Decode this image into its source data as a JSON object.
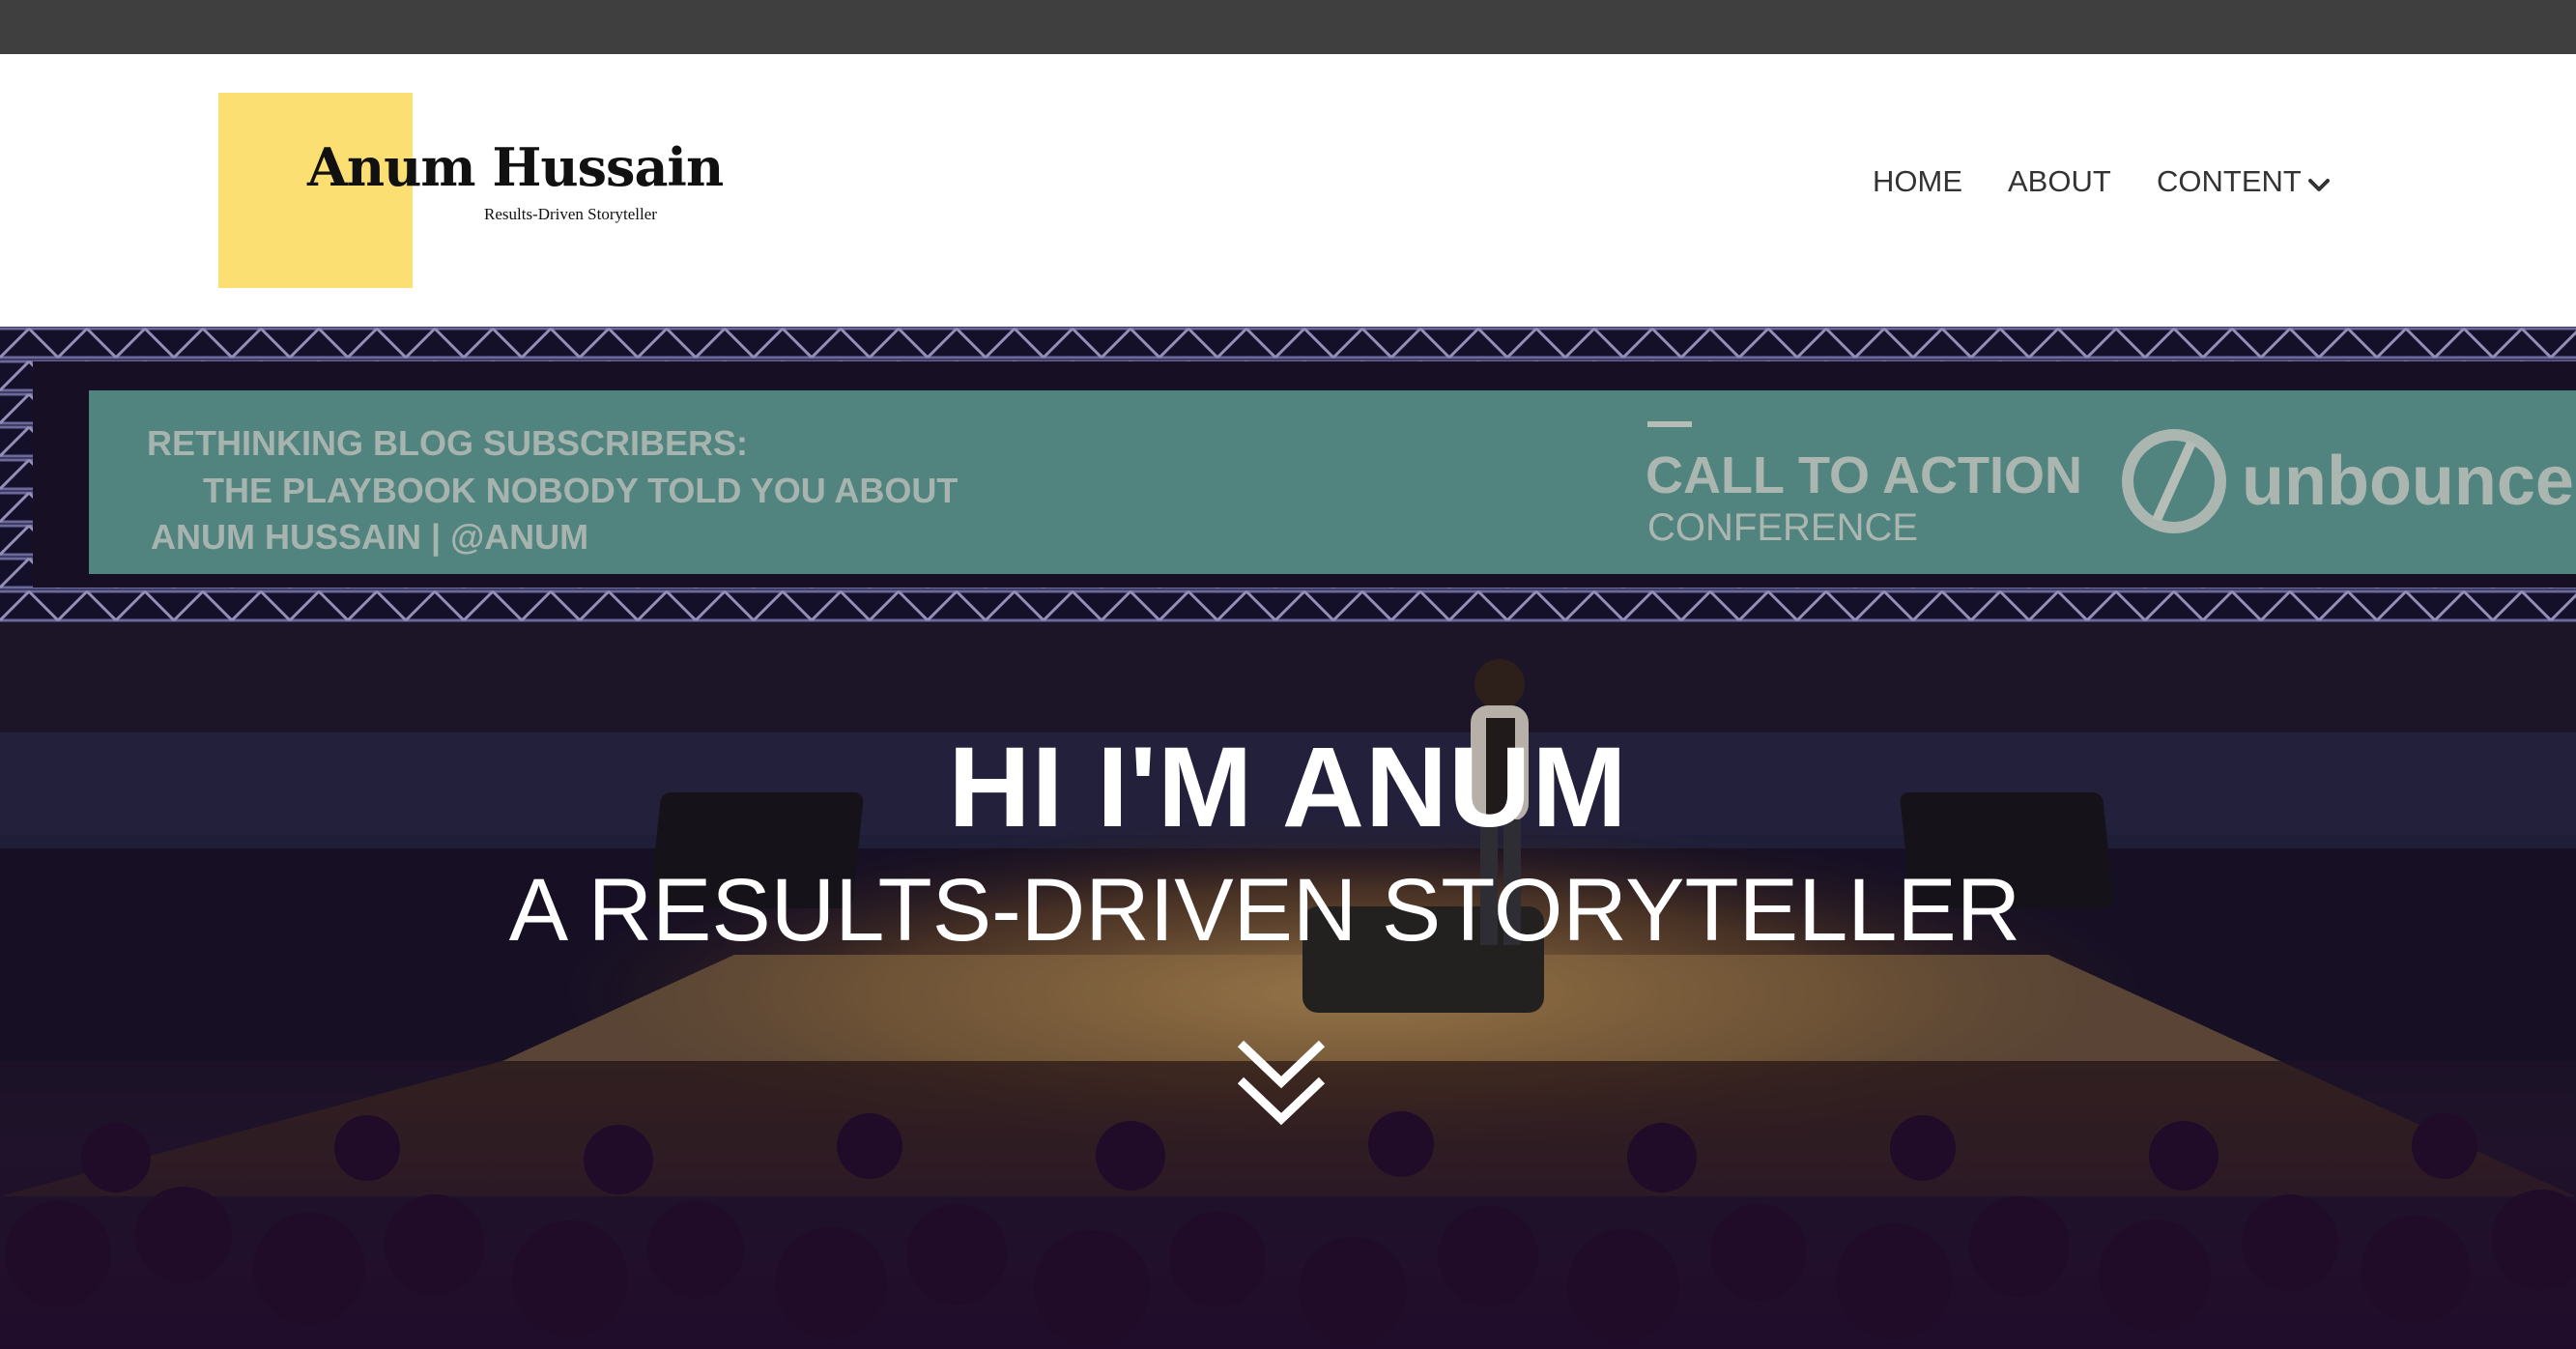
{
  "logo": {
    "name": "Anum Hussain",
    "tagline": "Results-Driven Storyteller",
    "accent_color": "#fbdf73"
  },
  "nav": {
    "items": [
      {
        "label": "HOME"
      },
      {
        "label": "ABOUT"
      },
      {
        "label": "CONTENT",
        "icon": "chevron-down-icon"
      }
    ]
  },
  "hero": {
    "title": "HI I'M ANUM",
    "subtitle": "A RESULTS-DRIVEN STORYTELLER",
    "scroll_icon": "double-chevron-down-icon",
    "screen": {
      "line1": "RETHINKING BLOG SUBSCRIBERS:",
      "line2": "THE PLAYBOOK NOBODY TOLD YOU ABOUT",
      "line3": "ANUM HUSSAIN | @ANUM",
      "event_title": "CALL TO ACTION",
      "event_sub": "CONFERENCE",
      "brand": "unbounce",
      "screen_color": "#6fb7ad"
    }
  }
}
